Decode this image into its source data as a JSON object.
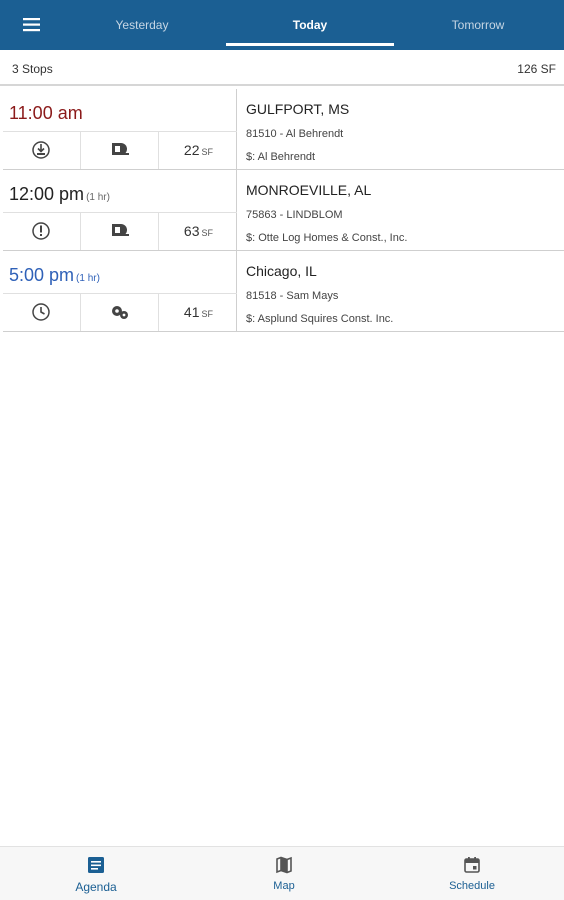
{
  "header": {
    "tabs": [
      {
        "label": "Yesterday",
        "active": false
      },
      {
        "label": "Today",
        "active": true
      },
      {
        "label": "Tomorrow",
        "active": false
      }
    ],
    "menu_icon": "hamburger-menu-icon",
    "color": "#1b5f93"
  },
  "summary": {
    "stops": "3 Stops",
    "total_sf": "126 SF"
  },
  "stops": [
    {
      "time": "11:00 am",
      "duration": "",
      "time_color": "#8b1a1a",
      "status_icon": "clock-down-arrow-icon",
      "type_icon": "tape-measure-icon",
      "sf_value": "22",
      "sf_unit": "SF",
      "city": "GULFPORT, MS",
      "job": "81510 - Al Behrendt",
      "customer": "$: Al Behrendt"
    },
    {
      "time": "12:00 pm",
      "duration": "(1 hr)",
      "time_color": "#222222",
      "status_icon": "exclamation-circle-icon",
      "type_icon": "tape-measure-icon",
      "sf_value": "63",
      "sf_unit": "SF",
      "city": "MONROEVILLE, AL",
      "job": "75863 - LINDBLOM",
      "customer": "$: Otte Log Homes & Const., Inc."
    },
    {
      "time": "5:00 pm",
      "duration": "(1 hr)",
      "time_color": "#2f61b8",
      "status_icon": "clock-icon",
      "type_icon": "gears-icon",
      "sf_value": "41",
      "sf_unit": "SF",
      "city": "Chicago, IL",
      "job": "81518 - Sam Mays",
      "customer": "$: Asplund Squires Const. Inc."
    }
  ],
  "bottom_nav": [
    {
      "label": "Agenda",
      "icon": "agenda-icon"
    },
    {
      "label": "Map",
      "icon": "map-icon"
    },
    {
      "label": "Schedule",
      "icon": "calendar-icon"
    }
  ]
}
